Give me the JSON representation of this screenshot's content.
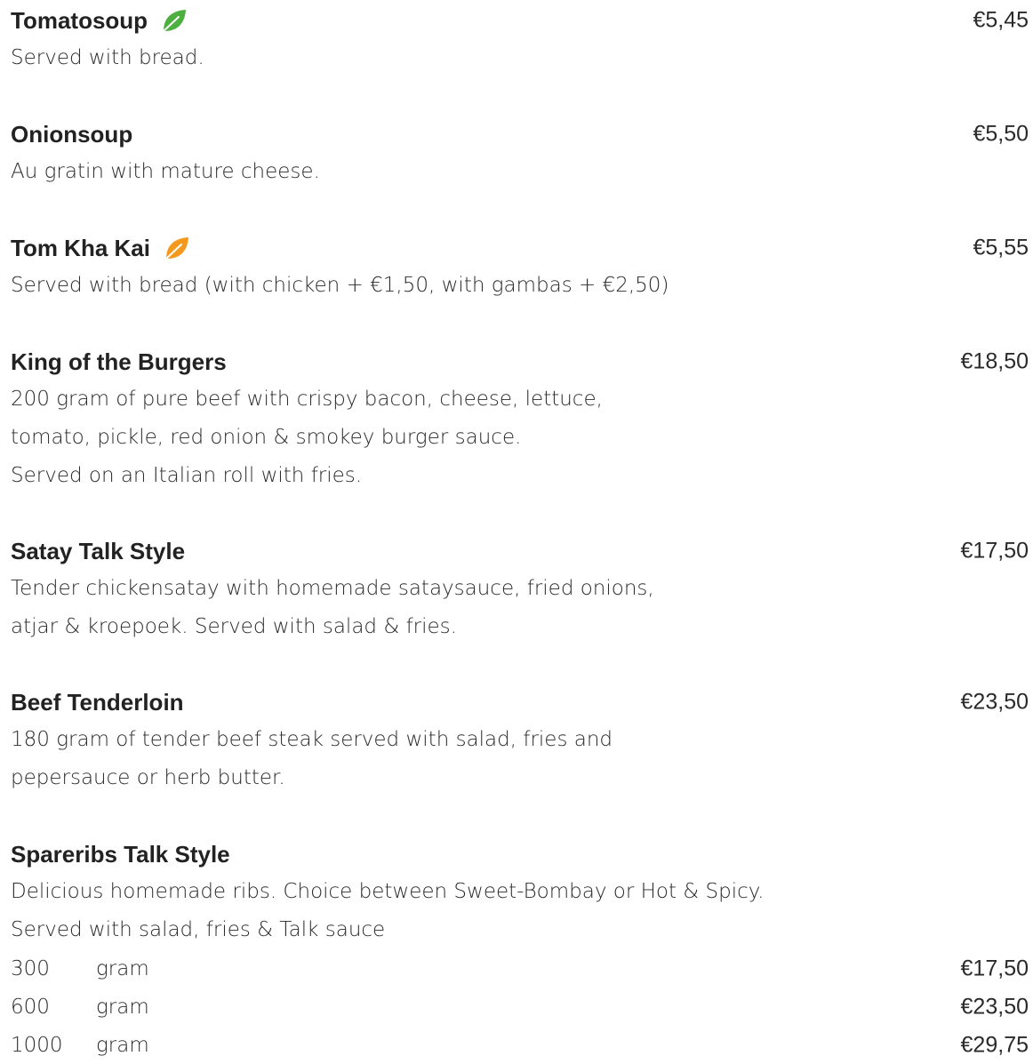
{
  "menu": {
    "items": [
      {
        "title": "Tomatosoup",
        "icon": "vegetarian-leaf-icon",
        "icon_color": "#4caf3f",
        "price": "€5,45",
        "description": [
          "Served with bread."
        ]
      },
      {
        "title": "Onionsoup",
        "price": "€5,50",
        "description": [
          "Au gratin with mature cheese."
        ]
      },
      {
        "title": "Tom Kha Kai",
        "icon": "spicy-leaf-icon",
        "icon_color": "#f39a1e",
        "price": "€5,55",
        "description": [
          "Served with bread (with chicken + €1,50, with gambas + €2,50)"
        ]
      },
      {
        "title": "King of the Burgers",
        "price": "€18,50",
        "description": [
          "200 gram of pure beef with crispy bacon, cheese, lettuce,",
          "tomato, pickle, red onion & smokey burger sauce.",
          "Served on an Italian roll with fries."
        ]
      },
      {
        "title": "Satay Talk Style",
        "price": "€17,50",
        "description": [
          "Tender chickensatay with homemade sataysauce, fried onions,",
          "atjar & kroepoek. Served with salad & fries."
        ]
      },
      {
        "title": "Beef Tenderloin",
        "price": "€23,50",
        "description": [
          "180 gram of tender beef steak served with salad, fries and",
          "pepersauce or herb butter."
        ]
      },
      {
        "title": "Spareribs Talk Style",
        "price": "",
        "description": [
          "Delicious homemade ribs. Choice between Sweet-Bombay or Hot & Spicy.",
          "Served with salad, fries & Talk sauce"
        ],
        "options": [
          {
            "amount": "300",
            "unit": "gram",
            "price": "€17,50"
          },
          {
            "amount": "600",
            "unit": "gram",
            "price": "€23,50"
          },
          {
            "amount": "1000",
            "unit": "gram",
            "price": "€29,75"
          }
        ]
      }
    ]
  }
}
